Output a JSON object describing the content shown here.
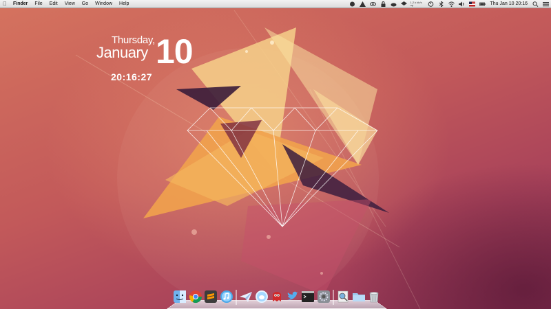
{
  "menubar": {
    "app_name": "Finder",
    "menus": [
      "File",
      "Edit",
      "View",
      "Go",
      "Window",
      "Help"
    ],
    "status_small_text": "1,2 k\nkb/s up",
    "clock": "Thu Jan 10  20:16"
  },
  "widget": {
    "weekday": "Thursday,",
    "month": "January",
    "day": "10",
    "time": "20:16:27"
  },
  "dock": {
    "items": [
      {
        "icon": "finder-icon"
      },
      {
        "icon": "chrome-icon"
      },
      {
        "icon": "sublime-text-icon"
      },
      {
        "icon": "itunes-icon"
      },
      {
        "icon": "paper-plane-icon"
      },
      {
        "icon": "messenger-bird-icon"
      },
      {
        "icon": "red-monster-icon"
      },
      {
        "icon": "twitter-icon"
      },
      {
        "icon": "terminal-icon"
      },
      {
        "icon": "system-preferences-icon"
      },
      {
        "icon": "preview-icon"
      },
      {
        "icon": "documents-folder-icon"
      },
      {
        "icon": "trash-icon"
      }
    ]
  },
  "colors": {
    "wallpaper_base": "#c2595a",
    "accent_yellow": "#f4c27a",
    "accent_orange": "#e7893f",
    "accent_dark": "#4a2240"
  }
}
